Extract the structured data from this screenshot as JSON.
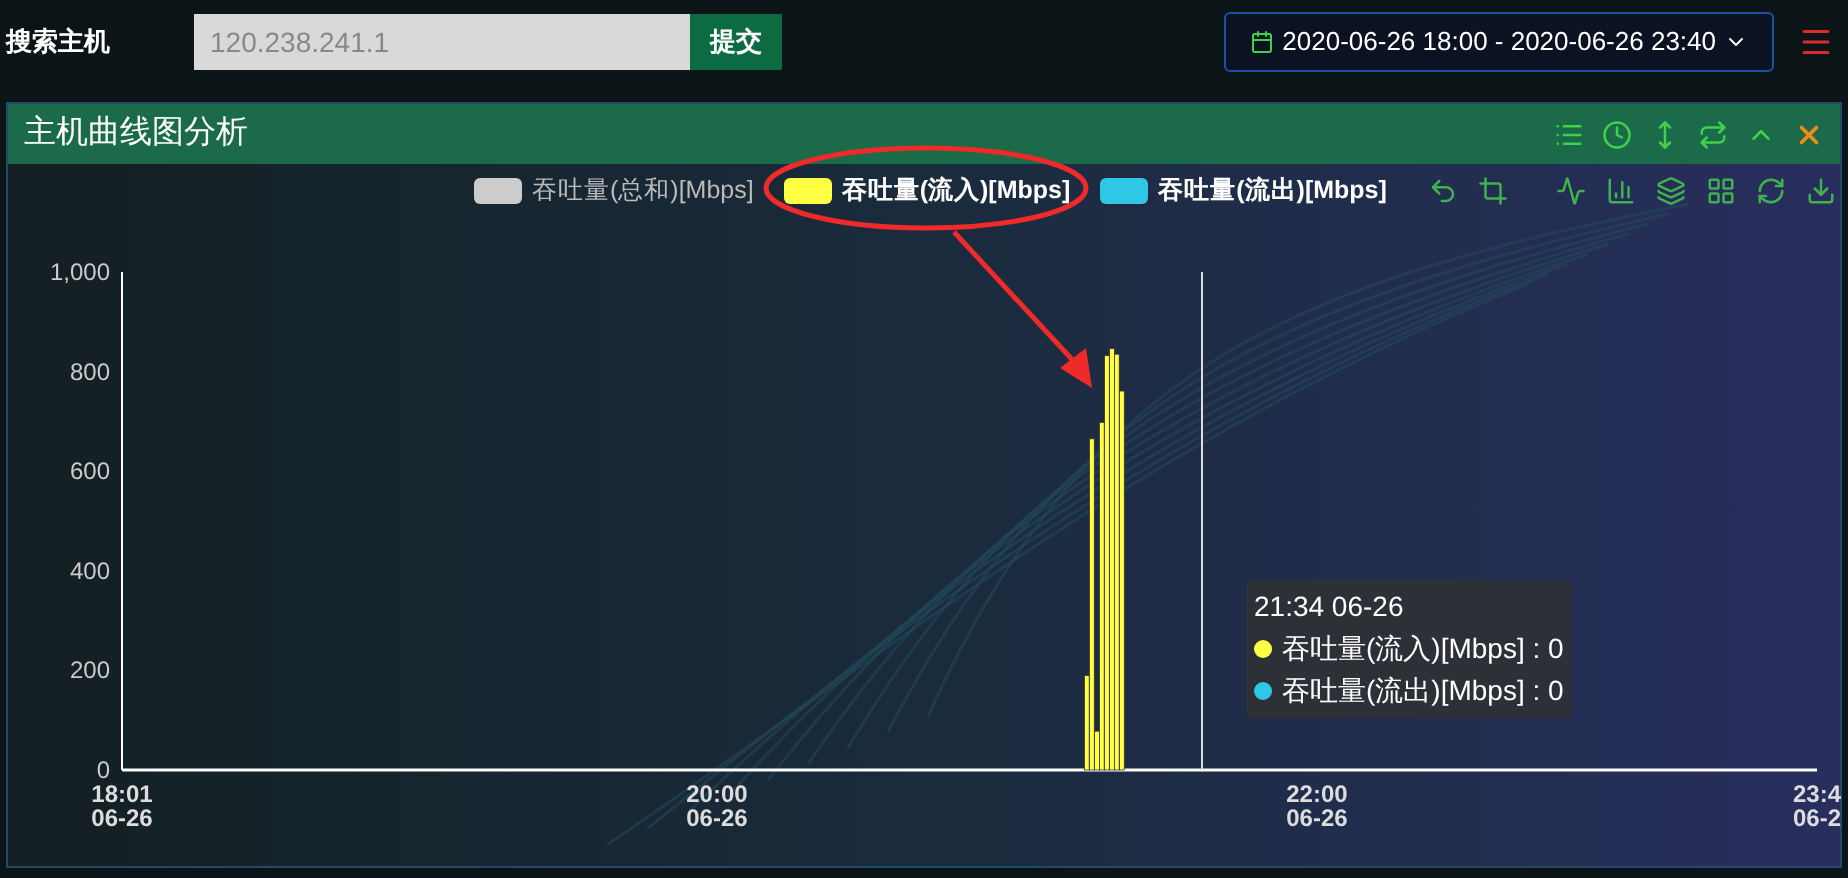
{
  "search": {
    "label": "搜索主机",
    "value": "120.238.241.1",
    "button": "提交"
  },
  "date_range": {
    "value": "2020-06-26 18:00 - 2020-06-26 23:40"
  },
  "panel": {
    "title": "主机曲线图分析",
    "chart": {
      "legend": [
        {
          "label": "吞吐量(总和)[Mbps]",
          "color": "#cccccc",
          "selected": false
        },
        {
          "label": "吞吐量(流入)[Mbps]",
          "color": "#ffff44",
          "selected": true
        },
        {
          "label": "吞吐量(流出)[Mbps]",
          "color": "#2ec7e6",
          "selected": true
        }
      ],
      "chart_data": {
        "type": "bar",
        "x": [
          21.233,
          21.25,
          21.267,
          21.283,
          21.3,
          21.317,
          21.333,
          21.35
        ],
        "series": [
          {
            "color": "#ffff44",
            "values": [
              190,
              665,
              78,
              698,
              832,
              846,
              835,
              761
            ]
          }
        ],
        "xlim": [
          18.017,
          23.667
        ],
        "ylim": [
          0,
          1000
        ],
        "xticks": [
          {
            "value": 18.017,
            "label": "18:01"
          },
          {
            "value": 20,
            "label": "20:00"
          },
          {
            "value": 22,
            "label": "22:00"
          },
          {
            "value": 23.667,
            "label": "23:4"
          }
        ],
        "yticks": [
          0,
          200,
          400,
          600,
          800,
          {
            "value": 1000,
            "label": "1,000"
          }
        ],
        "ref_lines": [
          {
            "axis": "x",
            "value": 21.617
          }
        ]
      },
      "x_date_labels": [
        "06-26",
        "06-26",
        "06-26",
        "06-2"
      ],
      "tooltip": {
        "title": "21:34 06-26",
        "rows": [
          {
            "text": "吞吐量(流入)[Mbps] : 0",
            "color": "#ffff44"
          },
          {
            "text": "吞吐量(流出)[Mbps] : 0",
            "color": "#2ec7e6"
          }
        ]
      }
    }
  }
}
